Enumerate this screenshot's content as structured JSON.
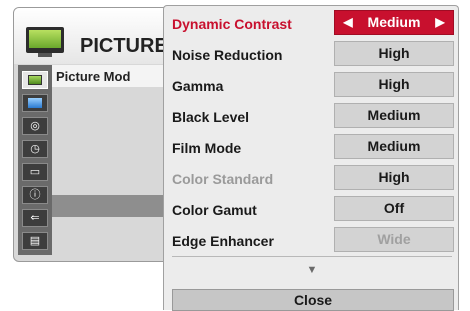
{
  "background_menu": {
    "title": "PICTURE",
    "selected_item": "Picture Mod",
    "icons": [
      "picture-icon",
      "screen-icon",
      "audio-icon",
      "clock-icon",
      "option-icon",
      "info-icon",
      "input-icon",
      "lock-icon"
    ]
  },
  "submenu": {
    "rows": [
      {
        "label": "Dynamic Contrast",
        "value": "Medium",
        "state": "selected"
      },
      {
        "label": "Noise Reduction",
        "value": "High",
        "state": "normal"
      },
      {
        "label": "Gamma",
        "value": "High",
        "state": "normal"
      },
      {
        "label": "Black Level",
        "value": "Medium",
        "state": "normal"
      },
      {
        "label": "Film Mode",
        "value": "Medium",
        "state": "normal"
      },
      {
        "label": "Color Standard",
        "value": "High",
        "state": "label-disabled"
      },
      {
        "label": "Color Gamut",
        "value": "Off",
        "state": "normal"
      },
      {
        "label": "Edge Enhancer",
        "value": "Wide",
        "state": "value-disabled"
      }
    ],
    "arrows": {
      "left": "◀",
      "right": "▶",
      "more": "▼"
    },
    "close_label": "Close"
  },
  "colors": {
    "selected": "#c8102e",
    "panel_bg": "#ececec",
    "value_bg": "#d3d3d3",
    "disabled_text": "#9a9a9a"
  }
}
